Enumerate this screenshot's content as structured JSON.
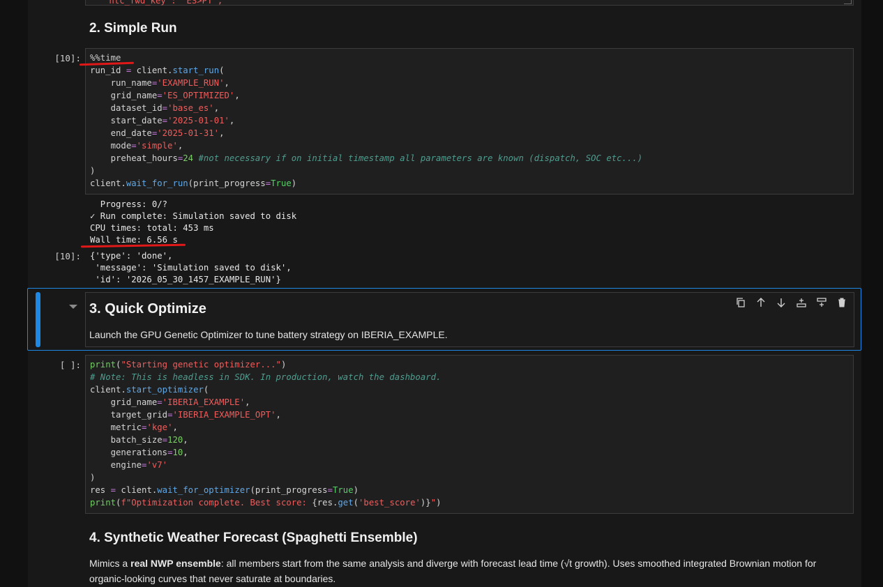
{
  "top_fragment": "'ntc_fwd_key': 'ES>PT',",
  "sections": {
    "simple_run_title": "2. Simple Run",
    "quick_opt_title": "3. Quick Optimize",
    "quick_opt_desc": "Launch the GPU Genetic Optimizer to tune battery strategy on IBERIA_EXAMPLE.",
    "weather_title": "4. Synthetic Weather Forecast (Spaghetti Ensemble)",
    "weather_desc_pre": "Mimics a ",
    "weather_desc_bold": "real NWP ensemble",
    "weather_desc_post": ": all members start from the same analysis and diverge with forecast lead time (√t growth). Uses smoothed integrated Brownian motion for",
    "weather_desc_line2": "organic-looking curves that never saturate at boundaries."
  },
  "cell10": {
    "prompt": "[10]:",
    "lines": [
      "%%time",
      "run_id = client.start_run(",
      "run_name='EXAMPLE_RUN',",
      "grid_name='ES_OPTIMIZED',",
      "dataset_id='base_es',",
      "start_date='2025-01-01',",
      "end_date='2025-01-31',",
      "mode='simple',",
      "preheat_hours=24 #not necessary if on initial timestamp all parameters are known (dispatch, SOC etc...)",
      ")",
      "client.wait_for_run(print_progress=True)"
    ],
    "stream_output": [
      "  Progress: 0/?",
      "✓ Run complete: Simulation saved to disk",
      "CPU times: total: 453 ms",
      "Wall time: 6.56 s"
    ],
    "result_prompt": "[10]:",
    "result": [
      "{'type': 'done',",
      " 'message': 'Simulation saved to disk',",
      " 'id': '2026_05_30_1457_EXAMPLE_RUN'}"
    ]
  },
  "cell_opt": {
    "prompt": "[ ]:",
    "lines": [
      "print(\"Starting genetic optimizer...\")",
      "# Note: This is headless in SDK. In production, watch the dashboard.",
      "client.start_optimizer(",
      "grid_name='IBERIA_EXAMPLE',",
      "target_grid='IBERIA_EXAMPLE_OPT',",
      "metric='kge',",
      "batch_size=120,",
      "generations=10,",
      "engine='v7'",
      ")",
      "res = client.wait_for_optimizer(print_progress=True)",
      "print(f\"Optimization complete. Best score: {res.get('best_score')}\")"
    ]
  },
  "toolbar": {
    "copy": "copy-icon",
    "up": "move-up-icon",
    "down": "move-down-icon",
    "insert_above": "insert-above-icon",
    "insert_below": "insert-below-icon",
    "delete": "delete-icon"
  },
  "colors": {
    "accent": "#1e88e5",
    "string": "#f05c5c",
    "function": "#5fa8e8",
    "number": "#7ccf68",
    "comment": "#4e9d8f",
    "annotation": "#e01818"
  }
}
